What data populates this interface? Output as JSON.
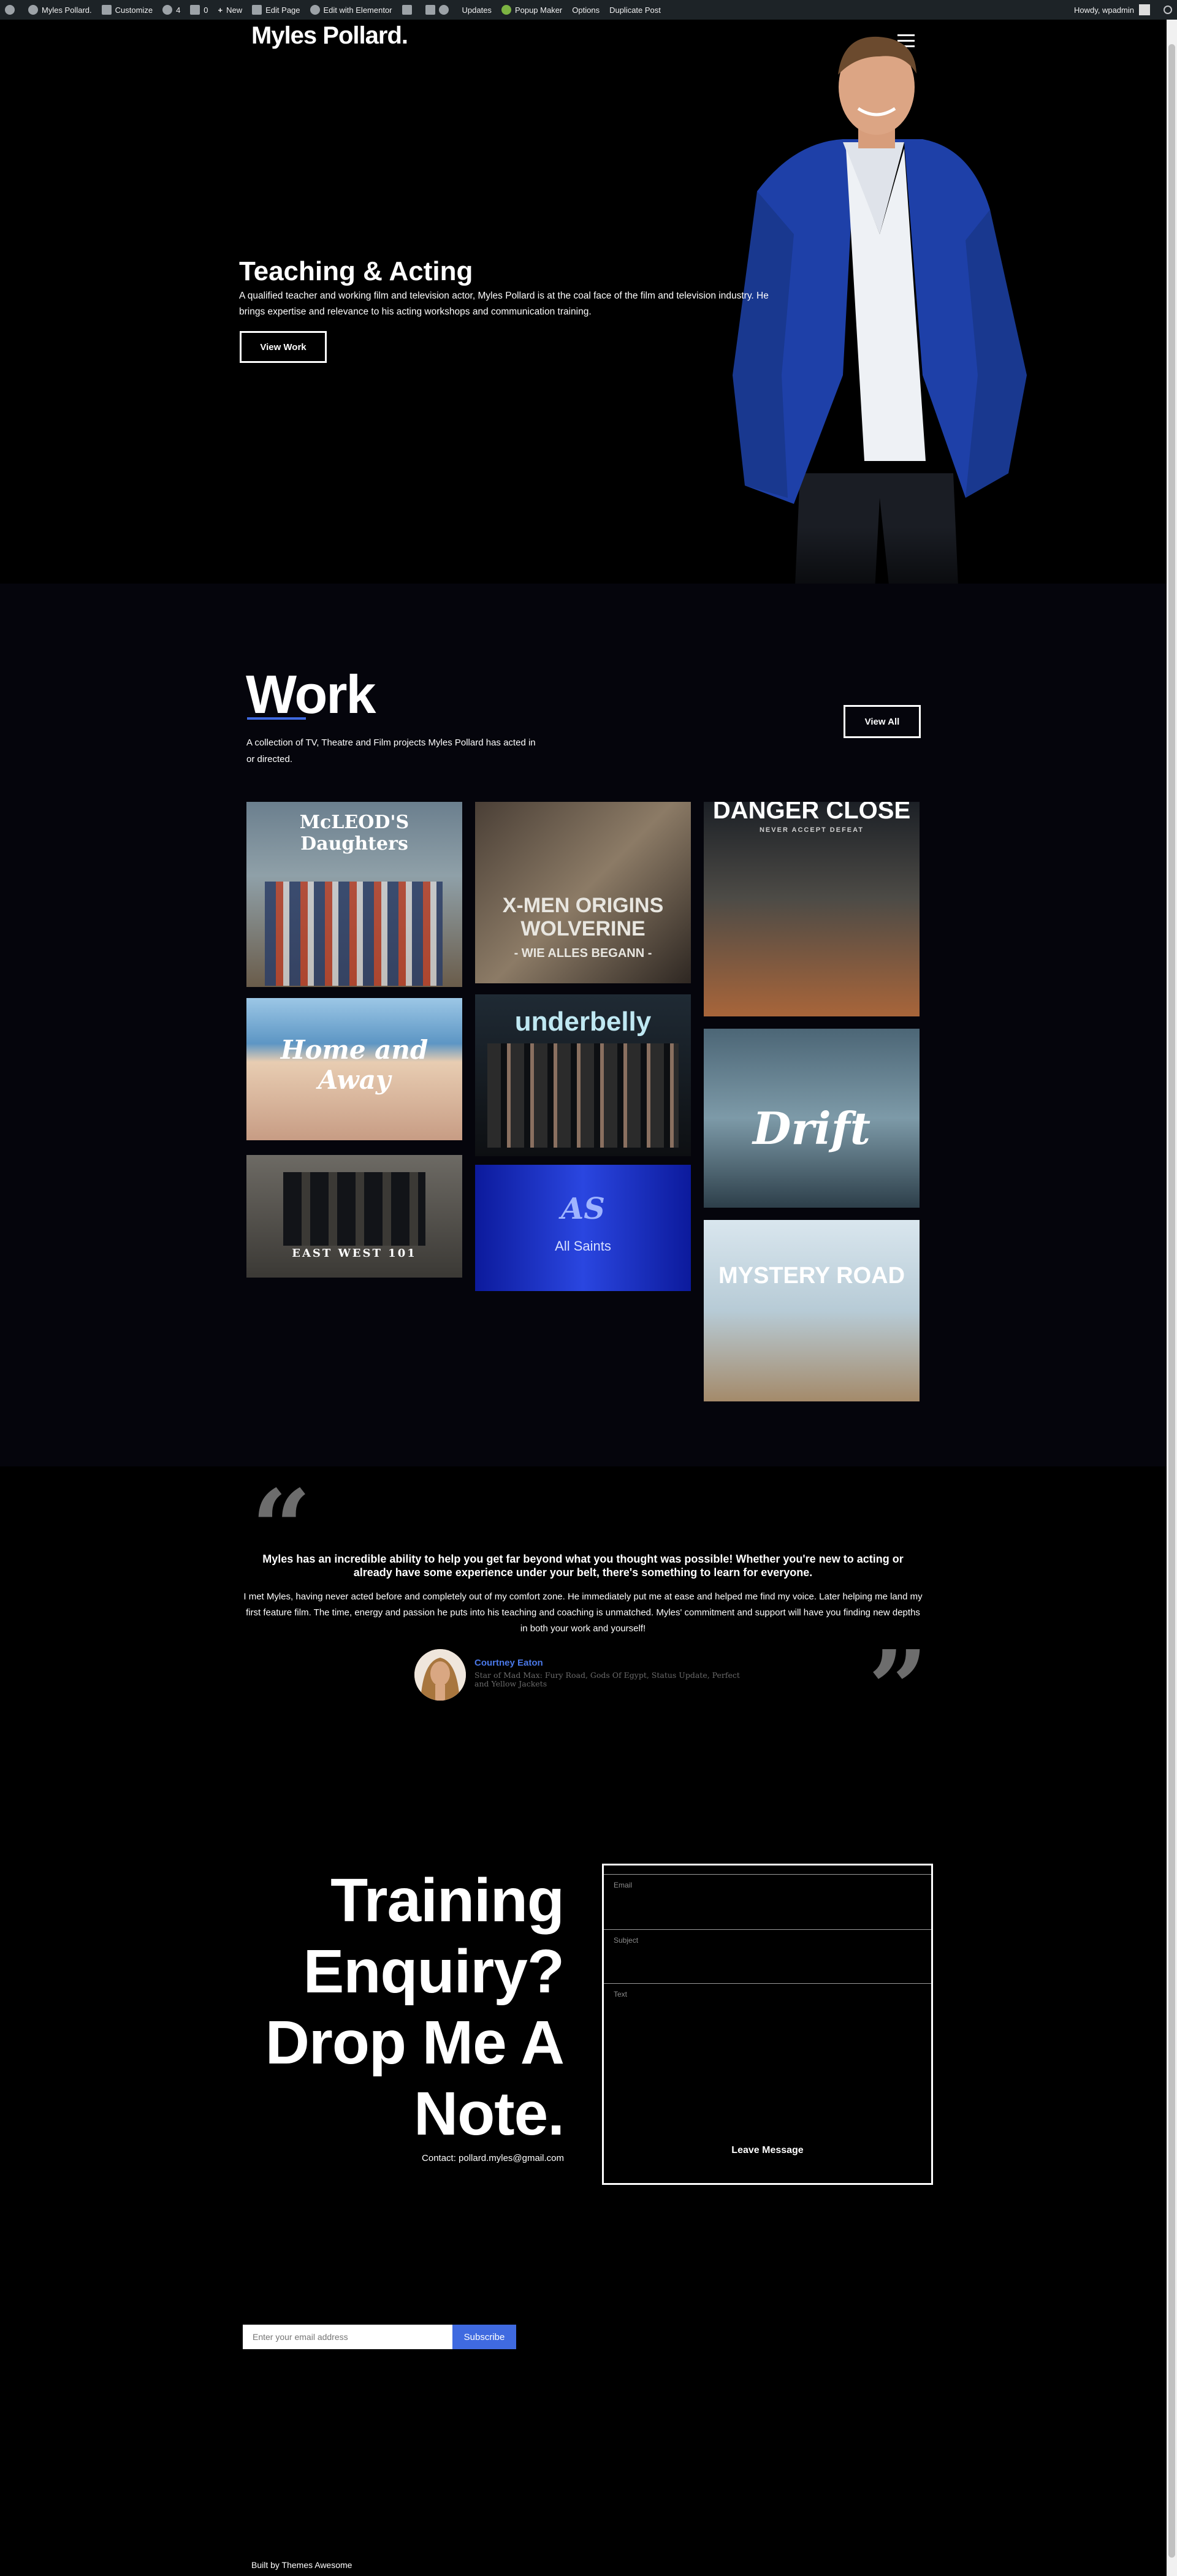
{
  "adminbar": {
    "site_name": "Myles Pollard.",
    "customize": "Customize",
    "updates_count": "4",
    "comments_count": "0",
    "new": "New",
    "edit_page": "Edit Page",
    "edit_elementor": "Edit with Elementor",
    "updates": "Updates",
    "popup_maker": "Popup Maker",
    "options": "Options",
    "duplicate_post": "Duplicate Post",
    "howdy": "Howdy, wpadmin"
  },
  "header": {
    "logo": "Myles Pollard."
  },
  "hero": {
    "title": "Teaching & Acting",
    "text": "A qualified teacher and working film and television actor, Myles Pollard is at the coal face of the film and television industry. He brings expertise and relevance to his acting workshops and communication training.",
    "button": "View Work"
  },
  "work": {
    "title": "Work",
    "description": "A collection of TV, Theatre and Film projects Myles Pollard has acted in or directed.",
    "button": "View All",
    "posters": [
      {
        "title": "McLEOD'S Daughters"
      },
      {
        "title": "X-MEN ORIGINS WOLVERINE",
        "subtitle": "- WIE ALLES BEGANN -"
      },
      {
        "title": "DANGER CLOSE",
        "subtitle": "NEVER ACCEPT DEFEAT"
      },
      {
        "title": "Home and Away"
      },
      {
        "title": "underbelly"
      },
      {
        "title": "Drift"
      },
      {
        "title": "EAST WEST 101"
      },
      {
        "title": "AS",
        "subtitle": "All Saints"
      },
      {
        "title": "MYSTERY ROAD"
      }
    ]
  },
  "testimonial": {
    "open_quote": "“",
    "close_quote": "”",
    "headline": "Myles has an incredible ability to help you get far beyond what you thought was possible! Whether you're new to acting or already have some experience under your belt, there's something to learn for everyone.",
    "body": "I met Myles, having never acted before and completely out of my comfort zone. He immediately put me at ease and helped me find my voice. Later helping me land my first feature film. The time, energy and passion he puts into his teaching and coaching is unmatched. Myles' commitment and support will have you finding new depths in both your work and yourself!",
    "name": "Courtney Eaton",
    "role": "Star of Mad Max: Fury Road, Gods Of Egypt, Status Update, Perfect and Yellow Jackets"
  },
  "enquiry": {
    "title": "Training Enquiry? Drop Me A Note.",
    "contact": "Contact: pollard.myles@gmail.com",
    "fields": {
      "email": "Email",
      "subject": "Subject",
      "text": "Text"
    },
    "submit": "Leave Message"
  },
  "newsletter": {
    "placeholder": "Enter your email address",
    "button": "Subscribe"
  },
  "footer": {
    "text": "Built by Themes Awesome"
  },
  "colors": {
    "accent": "#3f6ae0",
    "background": "#000000",
    "work_background": "#05050c",
    "admin_bar": "#1d2327"
  }
}
